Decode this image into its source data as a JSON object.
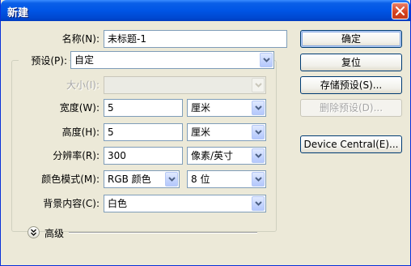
{
  "window": {
    "title": "新建"
  },
  "fields": {
    "name": {
      "label": "名称(N):",
      "value": "未标题-1"
    },
    "preset": {
      "label": "预设(P):",
      "value": "自定"
    },
    "size": {
      "label": "大小(I):",
      "value": ""
    },
    "width": {
      "label": "宽度(W):",
      "value": "5",
      "unit": "厘米"
    },
    "height": {
      "label": "高度(H):",
      "value": "5",
      "unit": "厘米"
    },
    "resolution": {
      "label": "分辨率(R):",
      "value": "300",
      "unit": "像素/英寸"
    },
    "color_mode": {
      "label": "颜色模式(M):",
      "value": "RGB 颜色",
      "depth": "8 位"
    },
    "background": {
      "label": "背景内容(C):",
      "value": "白色"
    }
  },
  "advanced": {
    "label": "高级"
  },
  "buttons": {
    "ok": "确定",
    "reset": "复位",
    "save_preset": "存储预设(S)...",
    "delete_preset": "删除预设(D)...",
    "device_central": "Device Central(E)..."
  }
}
